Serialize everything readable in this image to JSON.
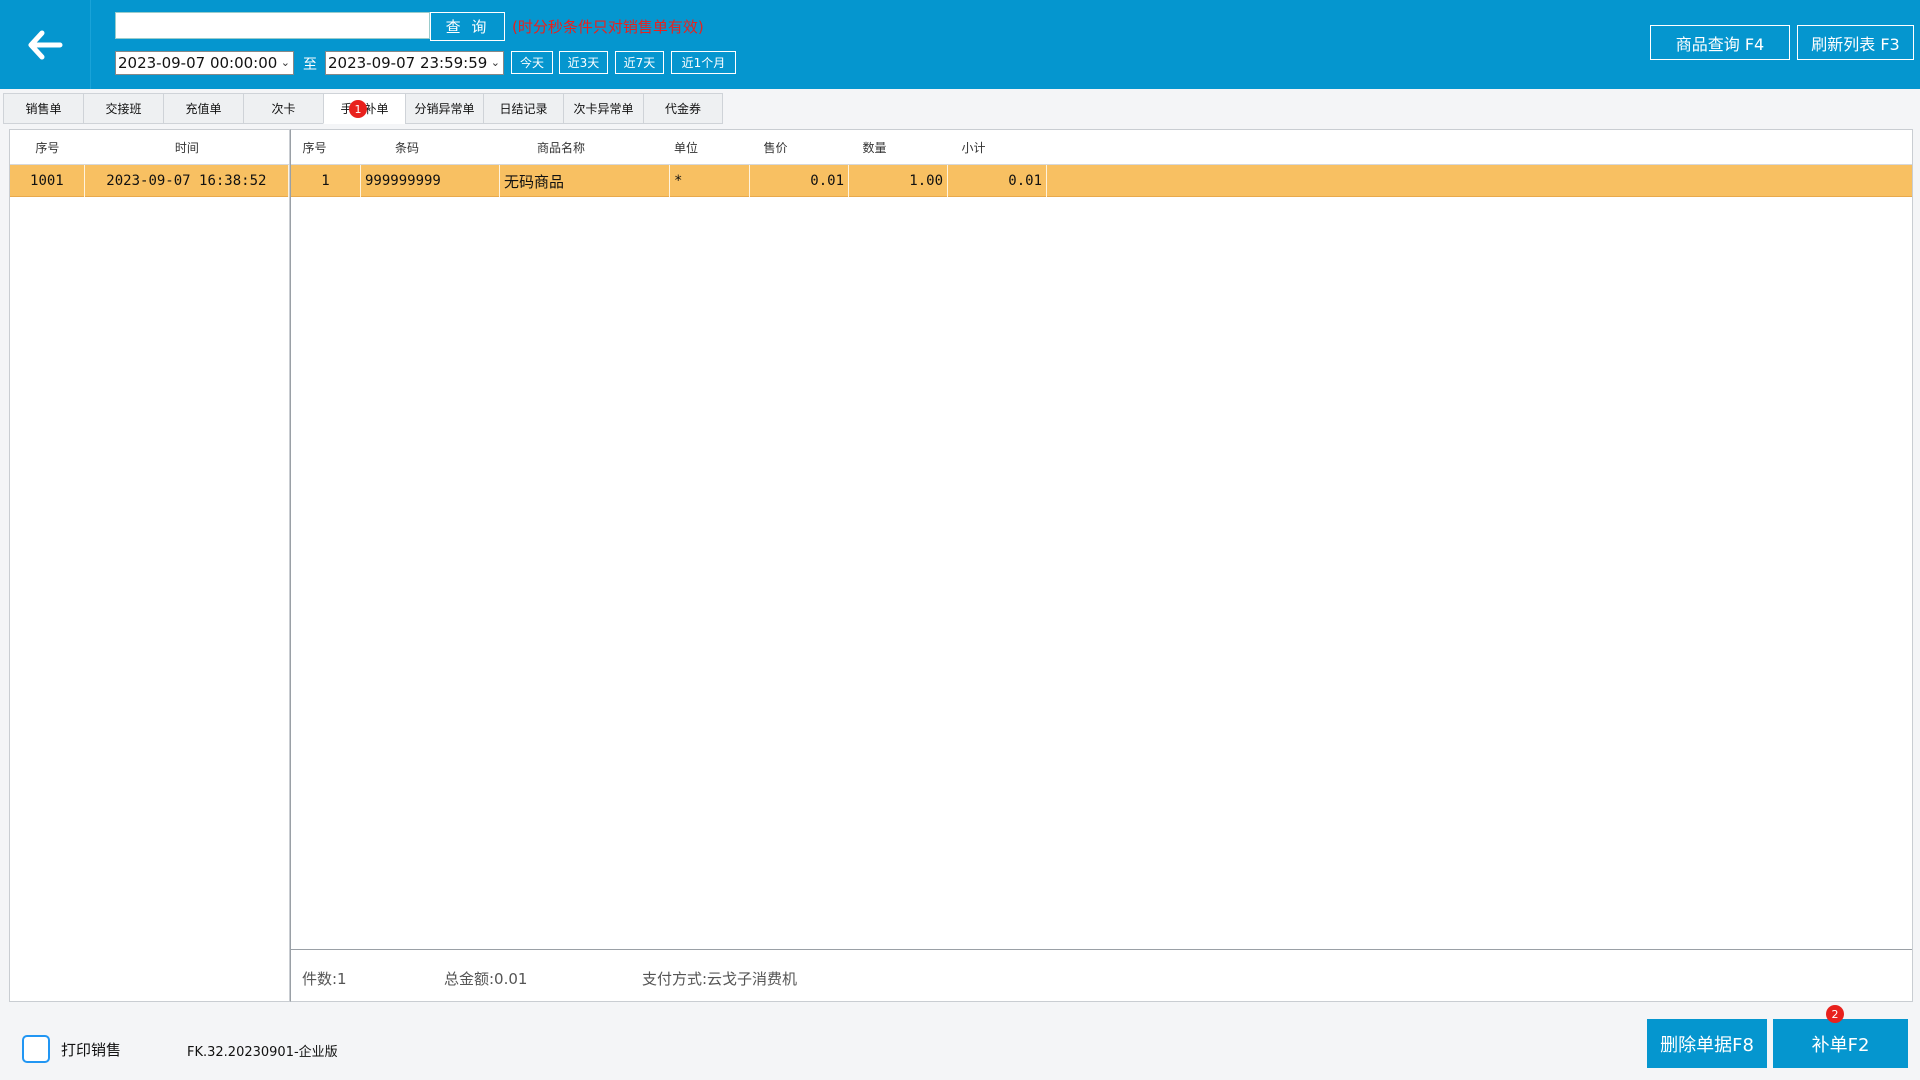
{
  "header": {
    "back_icon": "arrow-left-icon",
    "search_value": "",
    "query_label": "查 询",
    "hint": "(时分秒条件只对销售单有效)",
    "date_from": "2023-09-07 00:00:00",
    "date_to": "2023-09-07 23:59:59",
    "to_label": "至",
    "ranges": [
      "今天",
      "近3天",
      "近7天",
      "近1个月"
    ],
    "product_query_label": "商品查询 F4",
    "refresh_label": "刷新列表 F3"
  },
  "tabs": [
    {
      "label": "销售单"
    },
    {
      "label": "交接班"
    },
    {
      "label": "充值单"
    },
    {
      "label": "次卡"
    },
    {
      "label": "手工补单",
      "active": true,
      "badge": "1"
    },
    {
      "label": "分销异常单"
    },
    {
      "label": "日结记录"
    },
    {
      "label": "次卡异常单"
    },
    {
      "label": "代金券"
    }
  ],
  "left_table": {
    "columns": [
      "序号",
      "时间"
    ],
    "rows": [
      [
        "1001",
        "2023-09-07 16:38:52"
      ]
    ]
  },
  "right_table": {
    "columns": [
      "序号",
      "条码",
      "商品名称",
      "单位",
      "售价",
      "数量",
      "小计"
    ],
    "rows": [
      [
        "1",
        "999999999",
        "无码商品",
        "*",
        "0.01",
        "1.00",
        "0.01"
      ]
    ]
  },
  "summary": {
    "count": "件数:1",
    "total": "总金额:0.01",
    "payment": "支付方式:云戈子消费机"
  },
  "footer": {
    "print_label": "打印销售",
    "print_checked": false,
    "version": "FK.32.20230901-企业版",
    "delete_label": "删除单据F8",
    "supplement_label": "补单F2",
    "supplement_badge": "2"
  },
  "colors": {
    "brand": "#0596cf",
    "row_highlight": "#f8c062",
    "hint_red": "#e8211d"
  }
}
